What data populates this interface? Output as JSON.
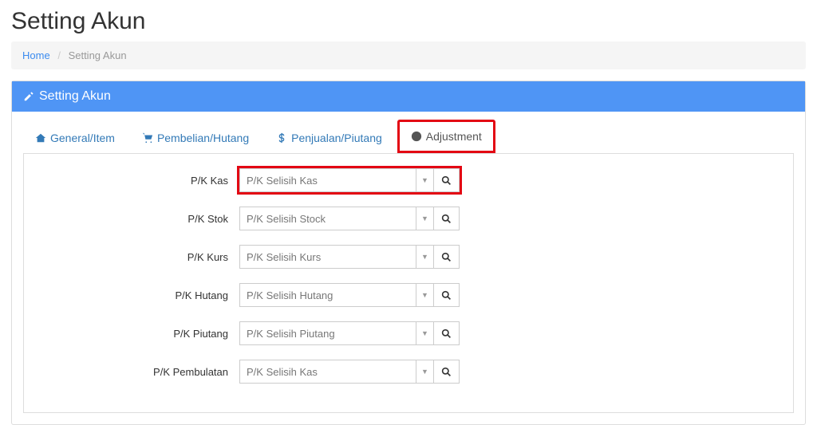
{
  "page": {
    "title": "Setting Akun"
  },
  "breadcrumb": {
    "home": "Home",
    "current": "Setting Akun"
  },
  "panel": {
    "title": "Setting Akun"
  },
  "tabs": {
    "general": "General/Item",
    "pembelian": "Pembelian/Hutang",
    "penjualan": "Penjualan/Piutang",
    "adjustment": "Adjustment"
  },
  "fields": {
    "kas": {
      "label": "P/K Kas",
      "value": "P/K Selisih Kas"
    },
    "stok": {
      "label": "P/K Stok",
      "value": "P/K Selisih Stock"
    },
    "kurs": {
      "label": "P/K Kurs",
      "value": "P/K Selisih Kurs"
    },
    "hutang": {
      "label": "P/K Hutang",
      "value": "P/K Selisih Hutang"
    },
    "piutang": {
      "label": "P/K Piutang",
      "value": "P/K Selisih Piutang"
    },
    "pembulatan": {
      "label": "P/K Pembulatan",
      "value": "P/K Selisih Kas"
    }
  }
}
